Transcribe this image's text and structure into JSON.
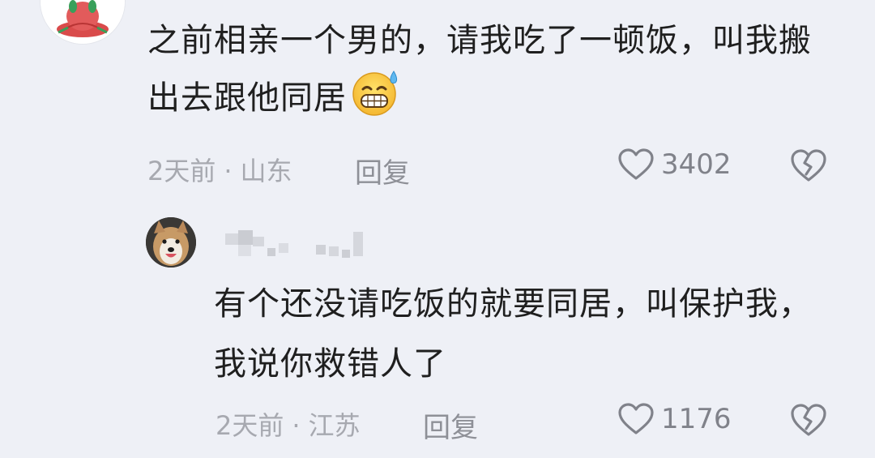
{
  "comments": [
    {
      "text": "之前相亲一个男的，请我吃了一顿饭，叫我搬出去跟他同居",
      "emoji": "grinning-sweat-emoji",
      "time": "2天前",
      "location": "山东",
      "reply_label": "回复",
      "likes": "3402"
    },
    {
      "text": "有个还没请吃饭的就要同居，叫保护我，我说你救错人了",
      "time": "2天前",
      "location": "江苏",
      "reply_label": "回复",
      "likes": "1176"
    }
  ],
  "separator": "·",
  "colors": {
    "background": "#eef0f6",
    "text": "#1f1f1f",
    "meta": "#a7a9b0",
    "icon": "#80828a"
  }
}
